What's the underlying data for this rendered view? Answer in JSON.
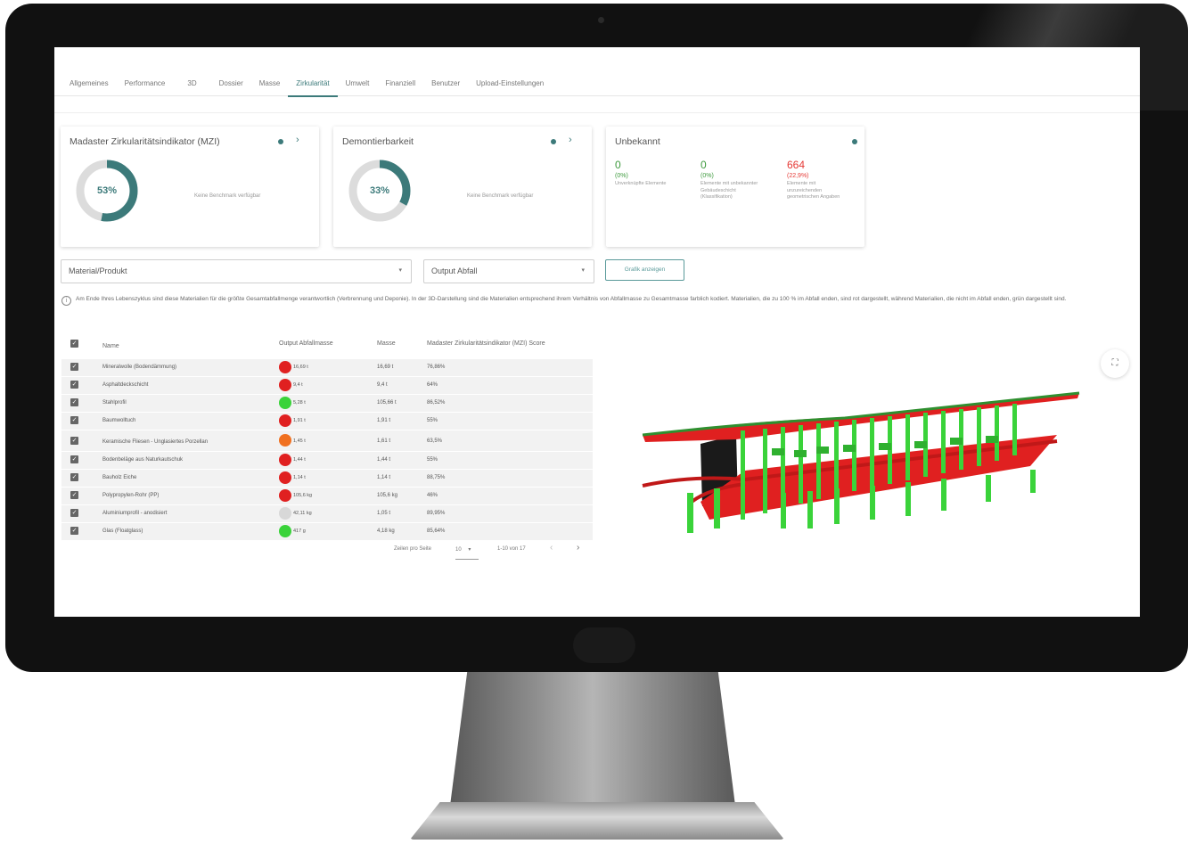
{
  "tabs": [
    {
      "label": "Allgemeines"
    },
    {
      "label": "Performance"
    },
    {
      "label": "3D"
    },
    {
      "label": "Dossier"
    },
    {
      "label": "Masse"
    },
    {
      "label": "Zirkularität",
      "active": true
    },
    {
      "label": "Umwelt"
    },
    {
      "label": "Finanziell"
    },
    {
      "label": "Benutzer"
    },
    {
      "label": "Upload-Einstellungen"
    }
  ],
  "cards": {
    "mzi": {
      "title": "Madaster Zirkularitätsindikator (MZI)",
      "value_label": "53%",
      "value": 0.53,
      "benchmark": "Keine Benchmark verfügbar"
    },
    "demontage": {
      "title": "Demontierbarkeit",
      "value_label": "33%",
      "value": 0.33,
      "benchmark": "Keine Benchmark verfügbar"
    },
    "unbekannt": {
      "title": "Unbekannt",
      "stats": [
        {
          "number": "0",
          "percent": "(0%)",
          "desc": "Unverknüpfte Elemente",
          "color": "#3e9a3e"
        },
        {
          "number": "0",
          "percent": "(0%)",
          "desc": "Elemente mit unbekannter Gebäudeschicht (Klassifikation)",
          "color": "#3e9a3e"
        },
        {
          "number": "664",
          "percent": "(22,9%)",
          "desc": "Elemente mit unzureichenden geometrischen Angaben",
          "color": "#e53935"
        }
      ]
    }
  },
  "filters": {
    "select1": "Material/Produkt",
    "select2": "Output Abfall",
    "button": "Grafik anzeigen"
  },
  "info_text": "Am Ende Ihres Lebenszyklus sind diese Materialien für die größte Gesamtabfallmenge verantwortlich (Verbrennung und Deponie). In der 3D-Darstellung sind die Materialien entsprechend ihrem Verhältnis von Abfallmasse zu Gesamtmasse farblich kodiert. Materialien, die zu 100 % im Abfall enden, sind rot dargestellt, während Materialien, die nicht im Abfall enden, grün dargestellt sind.",
  "table": {
    "headers": {
      "name": "Name",
      "output": "Output Abfallmasse",
      "masse": "Masse",
      "mzi": "Madaster Zirkularitätsindikator (MZI) Score"
    },
    "rows": [
      {
        "name": "Mineralwolle (Bodendämmung)",
        "output": "16,69 t",
        "masse": "16,69 t",
        "mzi": "76,86%",
        "status": "#e02020"
      },
      {
        "name": "Asphaltdeckschicht",
        "output": "9,4 t",
        "masse": "9,4 t",
        "mzi": "64%",
        "status": "#e02020"
      },
      {
        "name": "Stahlprofil",
        "output": "5,28 t",
        "masse": "105,66 t",
        "mzi": "86,52%",
        "status": "#3ad33a"
      },
      {
        "name": "Baumwolltuch",
        "output": "1,91 t",
        "masse": "1,91 t",
        "mzi": "55%",
        "status": "#e02020"
      },
      {
        "name": "Keramische Fliesen - Unglasiertes Porzellan",
        "output": "1,45 t",
        "masse": "1,61 t",
        "mzi": "63,5%",
        "status": "#f07020"
      },
      {
        "name": "Bodenbeläge aus Naturkautschuk",
        "output": "1,44 t",
        "masse": "1,44 t",
        "mzi": "55%",
        "status": "#e02020"
      },
      {
        "name": "Bauholz Eiche",
        "output": "1,14 t",
        "masse": "1,14 t",
        "mzi": "88,75%",
        "status": "#e02020"
      },
      {
        "name": "Polypropylen-Rohr (PP)",
        "output": "105,6 kg",
        "masse": "105,6 kg",
        "mzi": "46%",
        "status": "#e02020"
      },
      {
        "name": "Aluminiumprofil - anodisiert",
        "output": "42,11 kg",
        "masse": "1,05 t",
        "mzi": "89,95%",
        "status": "#d8d8d8"
      },
      {
        "name": "Glas (Floatglass)",
        "output": "417 g",
        "masse": "4,18 kg",
        "mzi": "85,64%",
        "status": "#3ad33a"
      }
    ]
  },
  "pagination": {
    "rows_label": "Zeilen pro Seite",
    "rows_value": "10",
    "range": "1-10 von 17"
  },
  "colors": {
    "accent": "#3c7a7a",
    "red": "#e53935",
    "green": "#3e9a3e"
  }
}
